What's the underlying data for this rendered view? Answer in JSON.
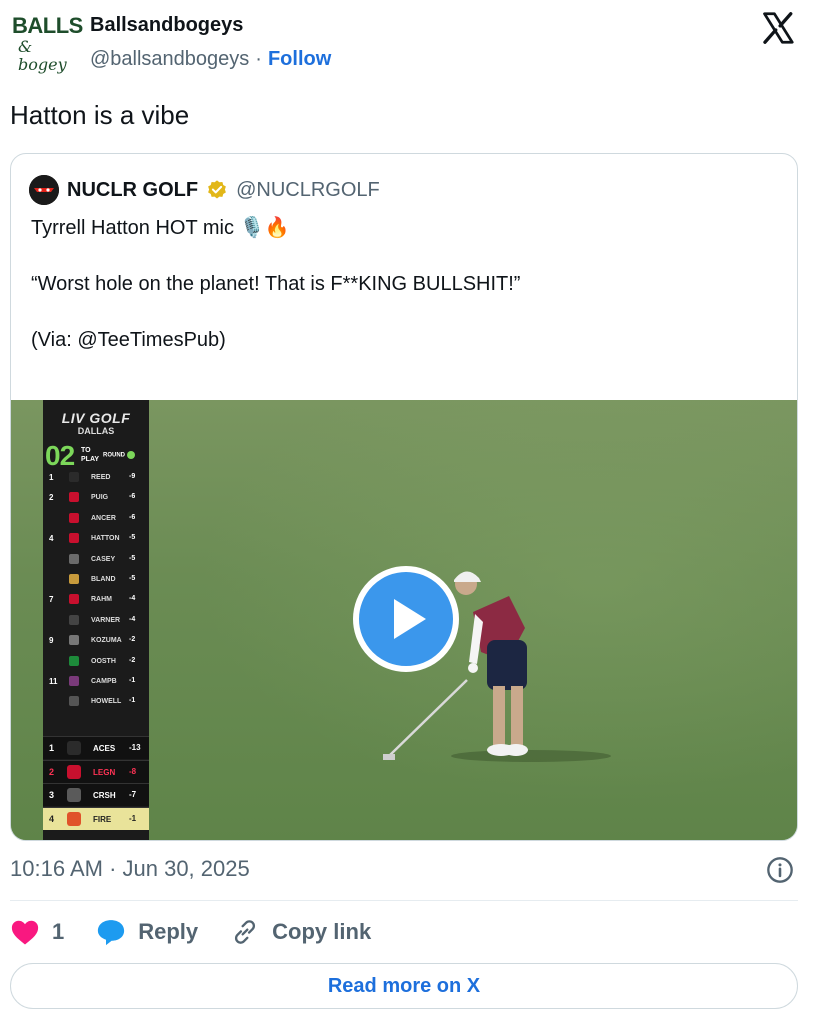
{
  "author": {
    "logo_line1": "BALLS",
    "logo_line2": "& bogey",
    "name": "Ballsandbogeys",
    "handle": "@ballsandbogeys",
    "separator": "·",
    "follow_label": "Follow"
  },
  "tweet": {
    "text": "Hatton is a vibe",
    "timestamp": "10:16 AM · Jun 30, 2025"
  },
  "quote": {
    "name": "NUCLR GOLF",
    "handle": "@NUCLRGOLF",
    "line1": "Tyrrell Hatton HOT mic 🎙️🔥",
    "line2": "“Worst hole on the planet! That is F**KING BULLSHIT!”",
    "line3": "(Via: @TeeTimesPub)"
  },
  "leaderboard": {
    "logo": "LIV GOLF",
    "city": "DALLAS",
    "to_play": "02",
    "to_play_label_1": "TO",
    "to_play_label_2": "PLAY",
    "round": "ROUND",
    "players": [
      {
        "pos": "1",
        "name": "REED",
        "score": "-9",
        "color": "#2b2b2b"
      },
      {
        "pos": "2",
        "name": "PUIG",
        "score": "-6",
        "color": "#c8102e"
      },
      {
        "pos": "",
        "name": "ANCER",
        "score": "-6",
        "color": "#c8102e"
      },
      {
        "pos": "4",
        "name": "HATTON",
        "score": "-5",
        "color": "#c8102e"
      },
      {
        "pos": "",
        "name": "CASEY",
        "score": "-5",
        "color": "#6b6b6b"
      },
      {
        "pos": "",
        "name": "BLAND",
        "score": "-5",
        "color": "#c89b3c"
      },
      {
        "pos": "7",
        "name": "RAHM",
        "score": "-4",
        "color": "#c8102e"
      },
      {
        "pos": "",
        "name": "VARNER",
        "score": "-4",
        "color": "#444444"
      },
      {
        "pos": "9",
        "name": "KOZUMA",
        "score": "-2",
        "color": "#777777"
      },
      {
        "pos": "",
        "name": "OOSTH",
        "score": "-2",
        "color": "#1d8a3a"
      },
      {
        "pos": "11",
        "name": "CAMPB",
        "score": "-1",
        "color": "#7a3a7a"
      },
      {
        "pos": "",
        "name": "HOWELL",
        "score": "-1",
        "color": "#555555"
      }
    ],
    "teams": [
      {
        "pos": "1",
        "name": "ACES",
        "score": "-13",
        "color": "#2b2b2b"
      },
      {
        "pos": "2",
        "name": "LEGN",
        "score": "-8",
        "color": "#c8102e"
      },
      {
        "pos": "3",
        "name": "CRSH",
        "score": "-7",
        "color": "#5a5a5a"
      },
      {
        "pos": "4",
        "name": "FIRE",
        "score": "-1",
        "color": "#e0532a"
      }
    ]
  },
  "actions": {
    "like_count": "1",
    "reply_label": "Reply",
    "copy_label": "Copy link"
  },
  "read_more_label": "Read more on X",
  "colors": {
    "link_blue": "#1d6fdc",
    "like_pink": "#f91880",
    "play_blue": "#3b97ec"
  }
}
